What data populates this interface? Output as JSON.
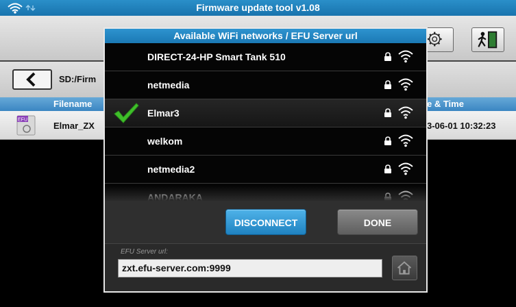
{
  "window": {
    "title": "Firmware update tool v1.08"
  },
  "toolbar": {
    "settings_icon": "gear-icon",
    "exit_icon": "exit-door-icon"
  },
  "path": {
    "back_icon": "chevron-left-icon",
    "text": "SD:/Firm"
  },
  "table": {
    "headers": {
      "filename": "Filename",
      "datetime": "e & Time"
    },
    "rows": [
      {
        "name": "Elmar_ZX",
        "datetime": "3-06-01 10:32:23",
        "icon": "efu-file-icon",
        "icon_label": "EFU"
      }
    ]
  },
  "dialog": {
    "title": "Available WiFi networks / EFU Server url",
    "networks": [
      {
        "ssid": "DIRECT-24-HP Smart Tank 510",
        "secured": true,
        "connected": false
      },
      {
        "ssid": "netmedia",
        "secured": true,
        "connected": false
      },
      {
        "ssid": "Elmar3",
        "secured": true,
        "connected": true
      },
      {
        "ssid": "welkom",
        "secured": true,
        "connected": false
      },
      {
        "ssid": "netmedia2",
        "secured": true,
        "connected": false
      },
      {
        "ssid": "ANDARAKA",
        "secured": true,
        "connected": false
      }
    ],
    "buttons": {
      "disconnect": "DISCONNECT",
      "done": "DONE"
    },
    "server": {
      "label": "EFU Server url:",
      "value": "zxt.efu-server.com:9999",
      "home_icon": "home-icon"
    }
  },
  "colors": {
    "accent": "#1b79b4",
    "button_blue": "#2a8fcf",
    "check_green": "#3fbf2a"
  }
}
